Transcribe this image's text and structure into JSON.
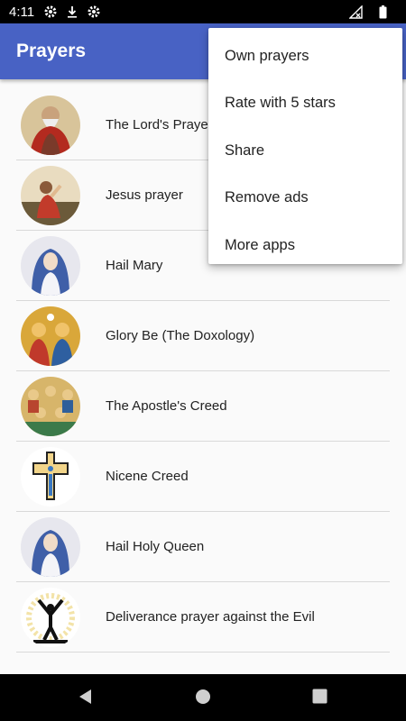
{
  "status_bar": {
    "time": "4:11"
  },
  "app_bar": {
    "title": "Prayers"
  },
  "list": {
    "items": [
      {
        "label": "The Lord's Prayer",
        "image": "god-father-painting"
      },
      {
        "label": "Jesus prayer",
        "image": "jesus-praying-painting"
      },
      {
        "label": "Hail Mary",
        "image": "virgin-mary-painting"
      },
      {
        "label": "Glory Be (The Doxology)",
        "image": "holy-trinity-icon"
      },
      {
        "label": "The Apostle's Creed",
        "image": "apostles-icon"
      },
      {
        "label": "Nicene Creed",
        "image": "orthodox-cross"
      },
      {
        "label": "Hail Holy Queen",
        "image": "virgin-mary-painting"
      },
      {
        "label": "Deliverance prayer against the Evil",
        "image": "raised-arms-silhouette"
      }
    ]
  },
  "overflow_menu": {
    "items": [
      "Own prayers",
      "Rate with 5 stars",
      "Share",
      "Remove ads",
      "More apps"
    ]
  },
  "colors": {
    "app_bar": "#4862c4",
    "background": "#fafafa",
    "divider": "#d9d9d9"
  }
}
